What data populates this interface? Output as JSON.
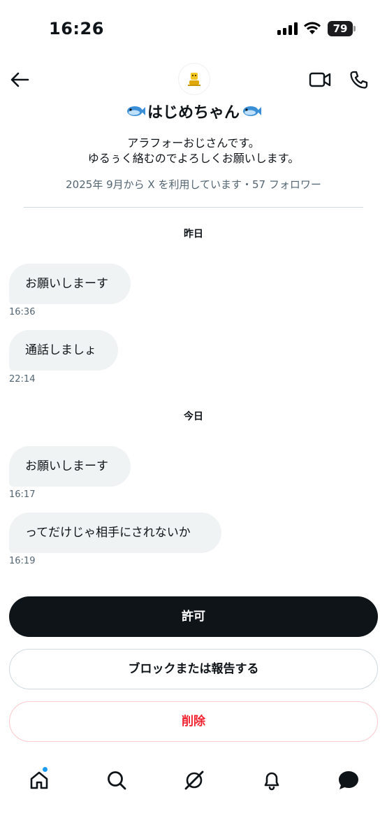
{
  "status_bar": {
    "time": "16:26",
    "battery": "79"
  },
  "profile": {
    "name": "はじめちゃん",
    "bio_line1": "アラフォーおじさんです。",
    "bio_line2": "ゆるぅく絡むのでよろしくお願いします。",
    "meta": "2025年 9月から X を利用しています・57 フォロワー"
  },
  "conversation": {
    "days": [
      {
        "label": "昨日",
        "messages": [
          {
            "text": "お願いしまーす",
            "time": "16:36"
          },
          {
            "text": "通話しましょ",
            "time": "22:14"
          }
        ]
      },
      {
        "label": "今日",
        "messages": [
          {
            "text": "お願いしまーす",
            "time": "16:17"
          },
          {
            "text": "ってだけじゃ相手にされないか",
            "time": "16:19"
          }
        ]
      }
    ]
  },
  "actions": {
    "allow_label": "許可",
    "block_report_label": "ブロックまたは報告する",
    "delete_label": "削除"
  },
  "nav": {
    "items": [
      "home-icon",
      "search-icon",
      "grok-icon",
      "notifications-icon",
      "messages-icon"
    ]
  },
  "colors": {
    "accent": "#1d9bf0",
    "danger": "#f4212e",
    "bubble": "#eff3f4",
    "primary": "#0f1419"
  }
}
